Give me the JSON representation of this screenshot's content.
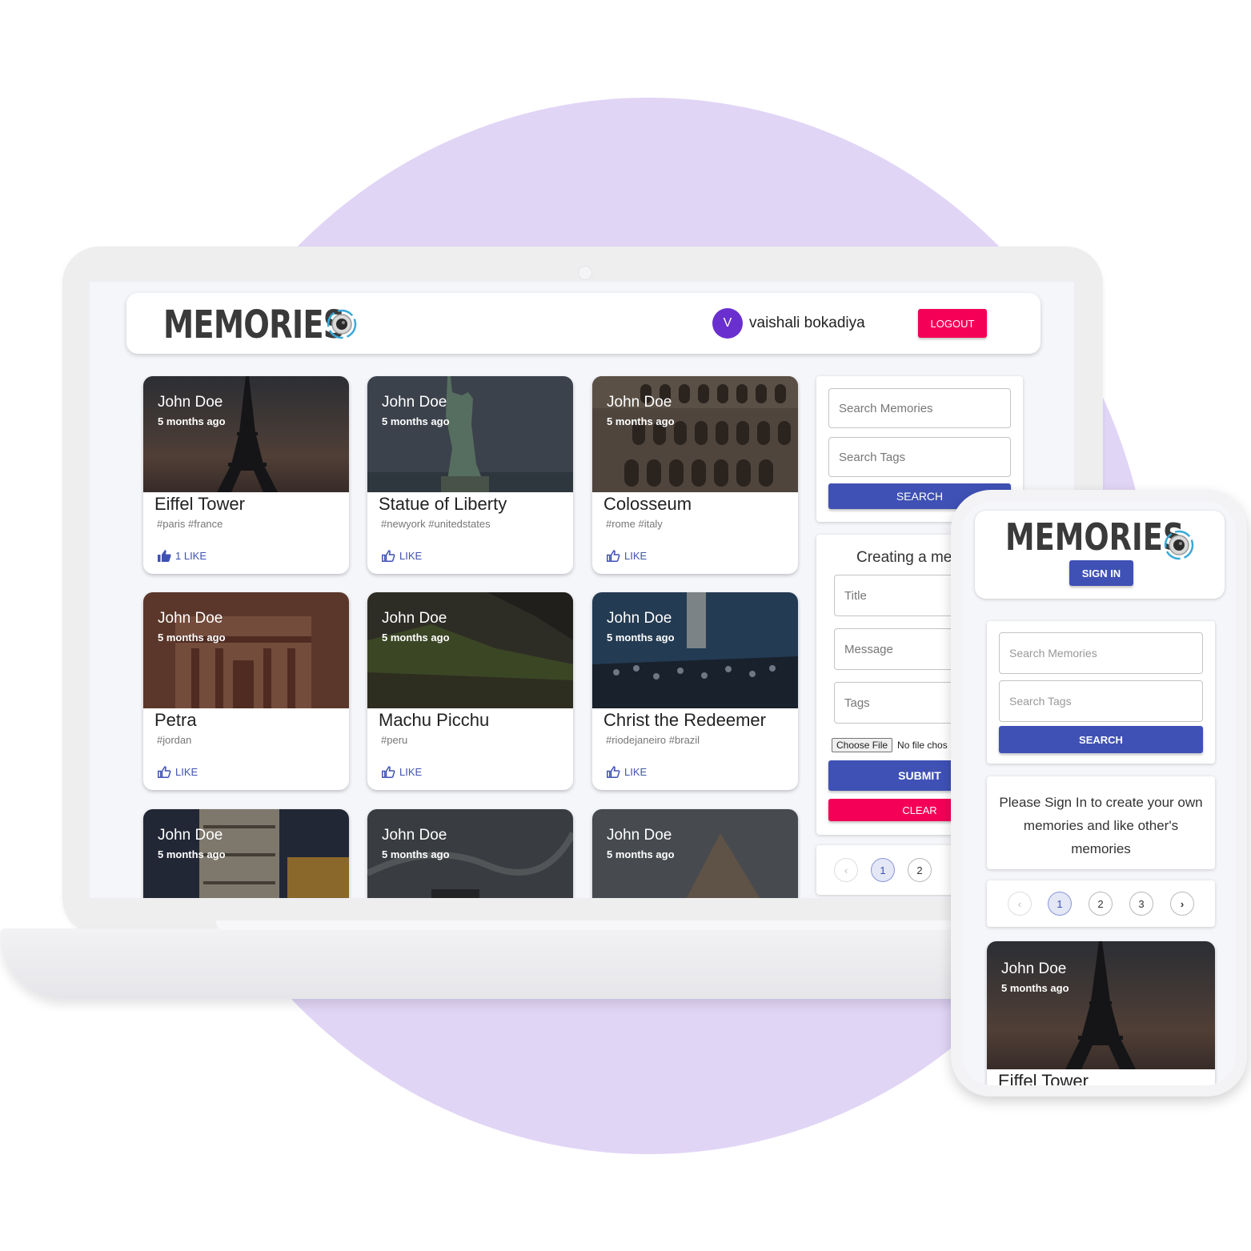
{
  "app": {
    "logo_text": "MEMORIES",
    "user": {
      "initial": "V",
      "name": "vaishali bokadiya"
    },
    "logout_label": "LOGOUT"
  },
  "colors": {
    "primary": "#3f51b5",
    "secondary": "#f50057",
    "avatar": "#6a2fcf",
    "background_circle": "#e1d5f6"
  },
  "posts": [
    {
      "author": "John Doe",
      "time": "5 months ago",
      "title": "Eiffel Tower",
      "tags": "#paris #france",
      "like": "1 LIKE"
    },
    {
      "author": "John Doe",
      "time": "5 months ago",
      "title": "Statue of Liberty",
      "tags": "#newyork #unitedstates",
      "like": "LIKE"
    },
    {
      "author": "John Doe",
      "time": "5 months ago",
      "title": "Colosseum",
      "tags": "#rome #italy",
      "like": "LIKE"
    },
    {
      "author": "John Doe",
      "time": "5 months ago",
      "title": "Petra",
      "tags": "#jordan",
      "like": "LIKE"
    },
    {
      "author": "John Doe",
      "time": "5 months ago",
      "title": "Machu Picchu",
      "tags": "#peru",
      "like": "LIKE"
    },
    {
      "author": "John Doe",
      "time": "5 months ago",
      "title": "Christ the Redeemer",
      "tags": "#riodejaneiro #brazil",
      "like": "LIKE"
    },
    {
      "author": "John Doe",
      "time": "5 months ago"
    },
    {
      "author": "John Doe",
      "time": "5 months ago"
    },
    {
      "author": "John Doe",
      "time": "5 months ago"
    }
  ],
  "search": {
    "memories_placeholder": "Search Memories",
    "tags_placeholder": "Search Tags",
    "button_label": "SEARCH"
  },
  "form": {
    "heading": "Creating a me",
    "title_placeholder": "Title",
    "message_placeholder": "Message",
    "tags_placeholder": "Tags",
    "choose_file_label": "Choose File",
    "no_file_text": "No file chos",
    "submit_label": "SUBMIT",
    "clear_label": "CLEAR"
  },
  "pagination": {
    "prev": "‹",
    "pages": [
      "1",
      "2"
    ],
    "selected": "1"
  },
  "mobile": {
    "logo_text": "MEMORIES",
    "sign_in_label": "SIGN IN",
    "search_memories_placeholder": "Search Memories",
    "search_tags_placeholder": "Search Tags",
    "search_label": "SEARCH",
    "signin_message": "Please Sign In to create your own memories and like other's memories",
    "pagination": {
      "prev": "‹",
      "pages": [
        "1",
        "2",
        "3"
      ],
      "next": "›",
      "selected": "1"
    },
    "post": {
      "author": "John Doe",
      "time": "5 months ago",
      "title": "Eiffel Tower"
    }
  }
}
